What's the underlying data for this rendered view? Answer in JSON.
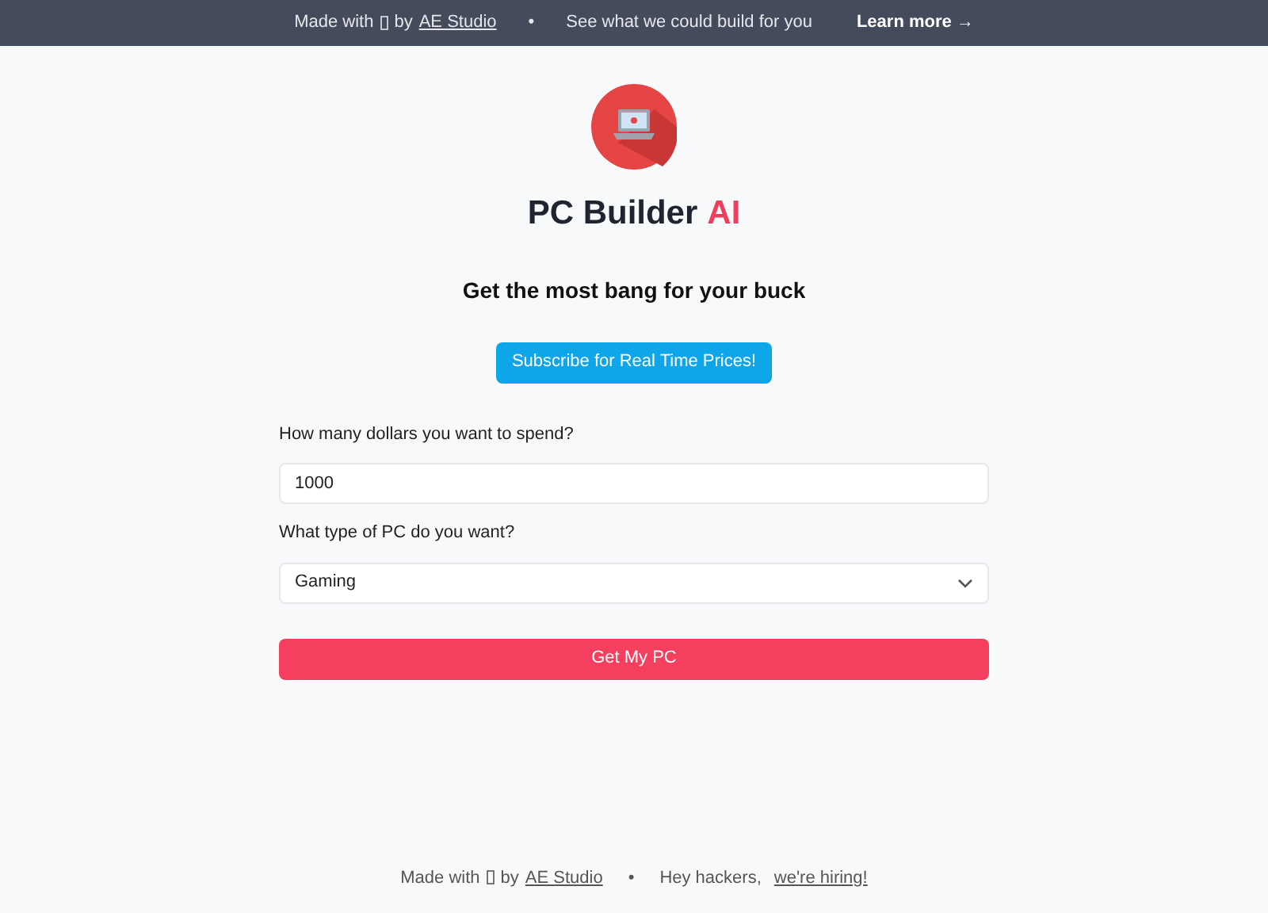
{
  "banner": {
    "made_with": "Made with",
    "by": "by",
    "studio_link": "AE Studio",
    "separator": "•",
    "pitch": "See what we could build for you",
    "learn_more": "Learn more →"
  },
  "header": {
    "title": "PC Builder",
    "title_accent": "AI",
    "tagline": "Get the most bang for your buck"
  },
  "subscribe_button": "Subscribe for Real Time Prices!",
  "form": {
    "budget_label": "How many dollars you want to spend?",
    "budget_value": "1000",
    "type_label": "What type of PC do you want?",
    "type_value": "Gaming",
    "submit": "Get My PC"
  },
  "footer": {
    "made_with": "Made with",
    "by": "by",
    "studio_link": "AE Studio",
    "separator": "•",
    "hackers": "Hey hackers,",
    "hiring_link": "we're hiring!"
  }
}
